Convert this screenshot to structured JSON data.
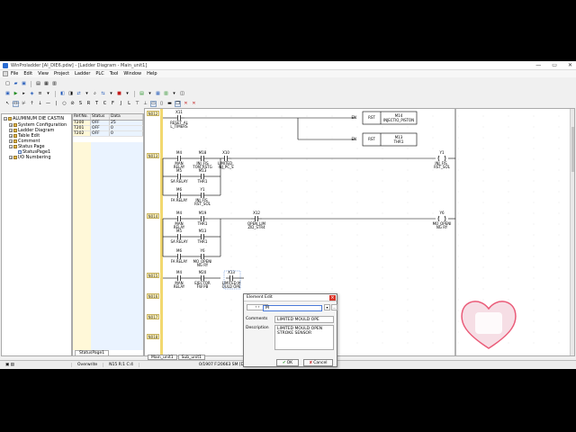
{
  "window": {
    "title": "WinProladder [Al_DIE6.pdw] - [Ladder Diagram - Main_unit1]",
    "min": "—",
    "max": "▭",
    "close": "✕"
  },
  "menu": [
    "File",
    "Edit",
    "View",
    "Project",
    "Ladder",
    "PLC",
    "Tool",
    "Window",
    "Help"
  ],
  "tree": {
    "root": "ALUMINUM DIE CASTIN",
    "items": [
      "System Configuration",
      "Ladder Diagram",
      "Table Edit",
      "Comment",
      "Status Page"
    ],
    "sub": "StatusPage1",
    "last": "I/O Numbering"
  },
  "status_table": {
    "headers": [
      "Ref.No.",
      "Status",
      "Data"
    ],
    "rows": [
      [
        "T200",
        "OFF",
        "25"
      ],
      [
        "T201",
        "OFF",
        "0"
      ],
      [
        "T202",
        "OFF",
        "0"
      ]
    ],
    "tab": "StatusPage1"
  },
  "ladder": {
    "rungs": [
      "N012",
      "N013",
      "N014",
      "N015",
      "N016",
      "N017",
      "N018"
    ],
    "contacts": [
      {
        "id": "X11",
        "label1": "RESET_AL",
        "label2": "L_TIMERS"
      },
      {
        "id": "M4",
        "label1": "MAN",
        "label2": "RELAY"
      },
      {
        "id": "M18",
        "label1": "INJ_FIS",
        "label2": "TON_RSTG"
      },
      {
        "id": "X10",
        "label1": "LIMITED_",
        "label2": "INJ_PC_S"
      },
      {
        "id": "M5",
        "label1": "SA RELAY",
        "label2": ""
      },
      {
        "id": "M13",
        "label1": "THR1",
        "label2": ""
      },
      {
        "id": "M6",
        "label1": "FA RELAY",
        "label2": ""
      },
      {
        "id": "Y1",
        "label1": "INJ_FIS_",
        "label2": "RST_SOL"
      },
      {
        "id": "M4",
        "label1": "MAN",
        "label2": "RELAY"
      },
      {
        "id": "M19",
        "label1": "THR1",
        "label2": ""
      },
      {
        "id": "X12",
        "label1": "OPEN_LIM",
        "label2": "ZID_STR4"
      },
      {
        "id": "M5",
        "label1": "SA RELAY",
        "label2": ""
      },
      {
        "id": "M13",
        "label1": "THR1",
        "label2": ""
      },
      {
        "id": "M6",
        "label1": "FA RELAY",
        "label2": ""
      },
      {
        "id": "Y6",
        "label1": "MO_OPENI",
        "label2": "NG RY"
      },
      {
        "id": "M4",
        "label1": "MAN",
        "label2": "RELAY"
      },
      {
        "id": "M20",
        "label1": "EJECTOR",
        "label2": "FW PB"
      },
      {
        "id": "X13",
        "label1": "LIMITED M",
        "label2": "OULD OPE"
      }
    ],
    "coils": [
      {
        "id": "Y1",
        "label1": "INJ_FIS_",
        "label2": "RST_SOL"
      },
      {
        "id": "Y6",
        "label1": "MO_OPENI",
        "label2": "NG RY"
      }
    ],
    "func_blocks": [
      {
        "op": "RST",
        "ref": "M14",
        "desc": "INJECTIO_PISTON",
        "en": "EN"
      },
      {
        "op": "RST",
        "ref": "M13",
        "desc": "THR1",
        "en": "EN"
      }
    ]
  },
  "bottom_tabs": [
    "Main_unit1",
    "Sub_unit1"
  ],
  "statusbar": {
    "mode": "Overwrite",
    "pos": "N15 R:1 C:4",
    "mem": "0/1907 F:20663 SM [Dev: 0/1327 F:7864]"
  },
  "dialog": {
    "title": "Element Edit",
    "close": "×",
    "nav": "‹ ›",
    "input": "M",
    "comments_label": "Comments",
    "comments_value": "LIMITED MOULD OPE",
    "description_label": "Description",
    "description_value": "LIMITED MOULD OPEN STROKE SENSOR",
    "ok": "OK",
    "cancel": "Cancel"
  },
  "colors": {
    "accent": "#2a6bd1",
    "rung_label": "#fff2b8",
    "table_ref": "#fff8d8",
    "table_data": "#eaf3ff",
    "heart": "#e84a6a"
  }
}
